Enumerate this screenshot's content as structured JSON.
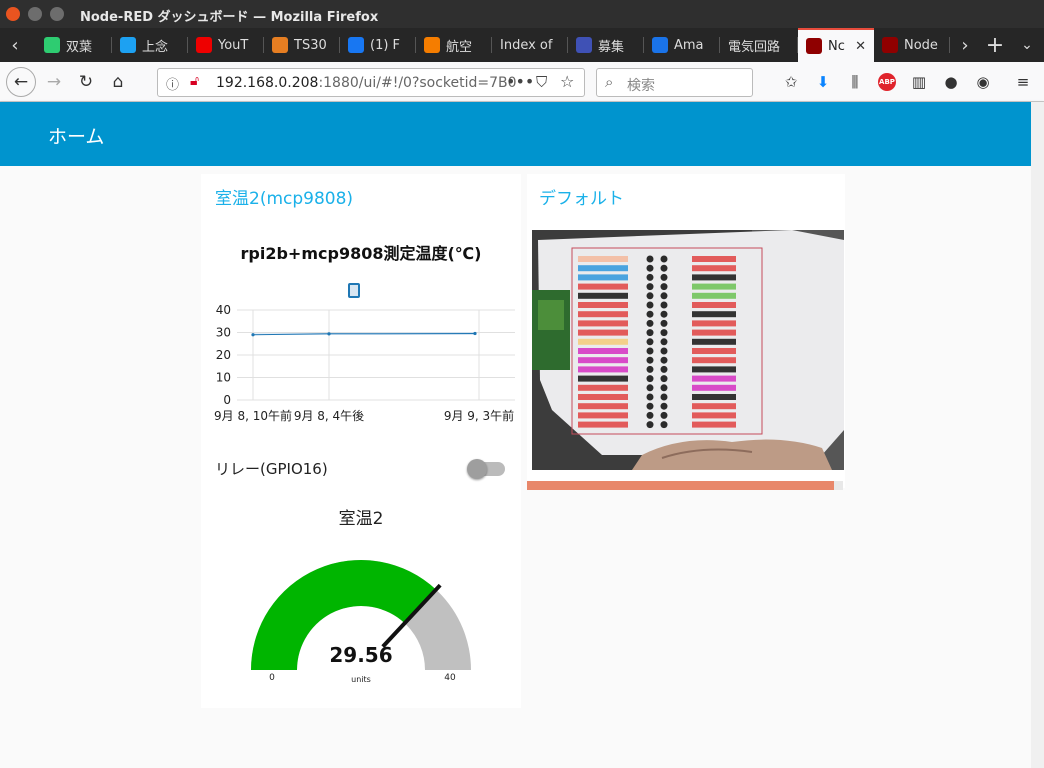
{
  "window": {
    "title": "Node-RED ダッシュボード — Mozilla Firefox"
  },
  "tabs": [
    {
      "label": "双葉",
      "icon": "sprout-icon",
      "color": "#2ecc71"
    },
    {
      "label": "上念",
      "icon": "twitter-icon",
      "color": "#1da1f2"
    },
    {
      "label": "YouT",
      "icon": "youtube-icon",
      "color": "#e00"
    },
    {
      "label": "TS30",
      "icon": "spinner-icon",
      "color": "#e67e22"
    },
    {
      "label": "(1) F",
      "icon": "facebook-icon",
      "color": "#1877f2"
    },
    {
      "label": "航空",
      "icon": "blogger-icon",
      "color": "#f57d00"
    },
    {
      "label": "Index of",
      "icon": "",
      "color": ""
    },
    {
      "label": "募集",
      "icon": "site-icon",
      "color": "#3f51b5"
    },
    {
      "label": "Ama",
      "icon": "map-pin-icon",
      "color": "#1a73e8"
    },
    {
      "label": "電気回路",
      "icon": "",
      "color": ""
    },
    {
      "label": "Nc",
      "icon": "node-red-icon",
      "color": "#8f0000"
    },
    {
      "label": "Node",
      "icon": "node-red-icon",
      "color": "#8f0000"
    }
  ],
  "nav": {
    "url_host": "192.168.0.208",
    "url_rest": ":1880/ui/#!/0?socketid=7B0",
    "search_placeholder": "検索"
  },
  "dashboard": {
    "header_title": "ホーム",
    "groups": [
      {
        "title": "室温2(mcp9808)",
        "chart": {
          "title": "rpi2b+mcp9808測定温度(℃)",
          "legend_color": "#1f77b4"
        },
        "switch": {
          "label": "リレー(GPIO16)",
          "state": "off"
        },
        "gauge": {
          "title": "室温2",
          "value_text": "29.56",
          "units": "units",
          "min_label": "0",
          "max_label": "40",
          "min": 0,
          "max": 40,
          "value": 29.56,
          "fill_color": "#00b500",
          "empty_color": "#c0c0c0"
        }
      },
      {
        "title": "デフォルト",
        "progress": 0.97,
        "progress_color": "#e8876a"
      }
    ]
  },
  "chart_data": {
    "type": "line",
    "title": "rpi2b+mcp9808測定温度(℃)",
    "xlabel": "",
    "ylabel": "",
    "ylim": [
      0,
      40
    ],
    "yticks": [
      0,
      10,
      20,
      30,
      40
    ],
    "xticks": [
      "9月 8, 10午前",
      "9月 8, 4午後",
      "9月 9, 3午前"
    ],
    "series": [
      {
        "x": [
          "9月 8, 9午前",
          "9月 8, 10午前",
          "9月 8, 4午後",
          "9月 9, 3午前"
        ],
        "y": [
          29.0,
          29.3,
          29.4,
          29.56
        ]
      }
    ],
    "grid": true
  }
}
